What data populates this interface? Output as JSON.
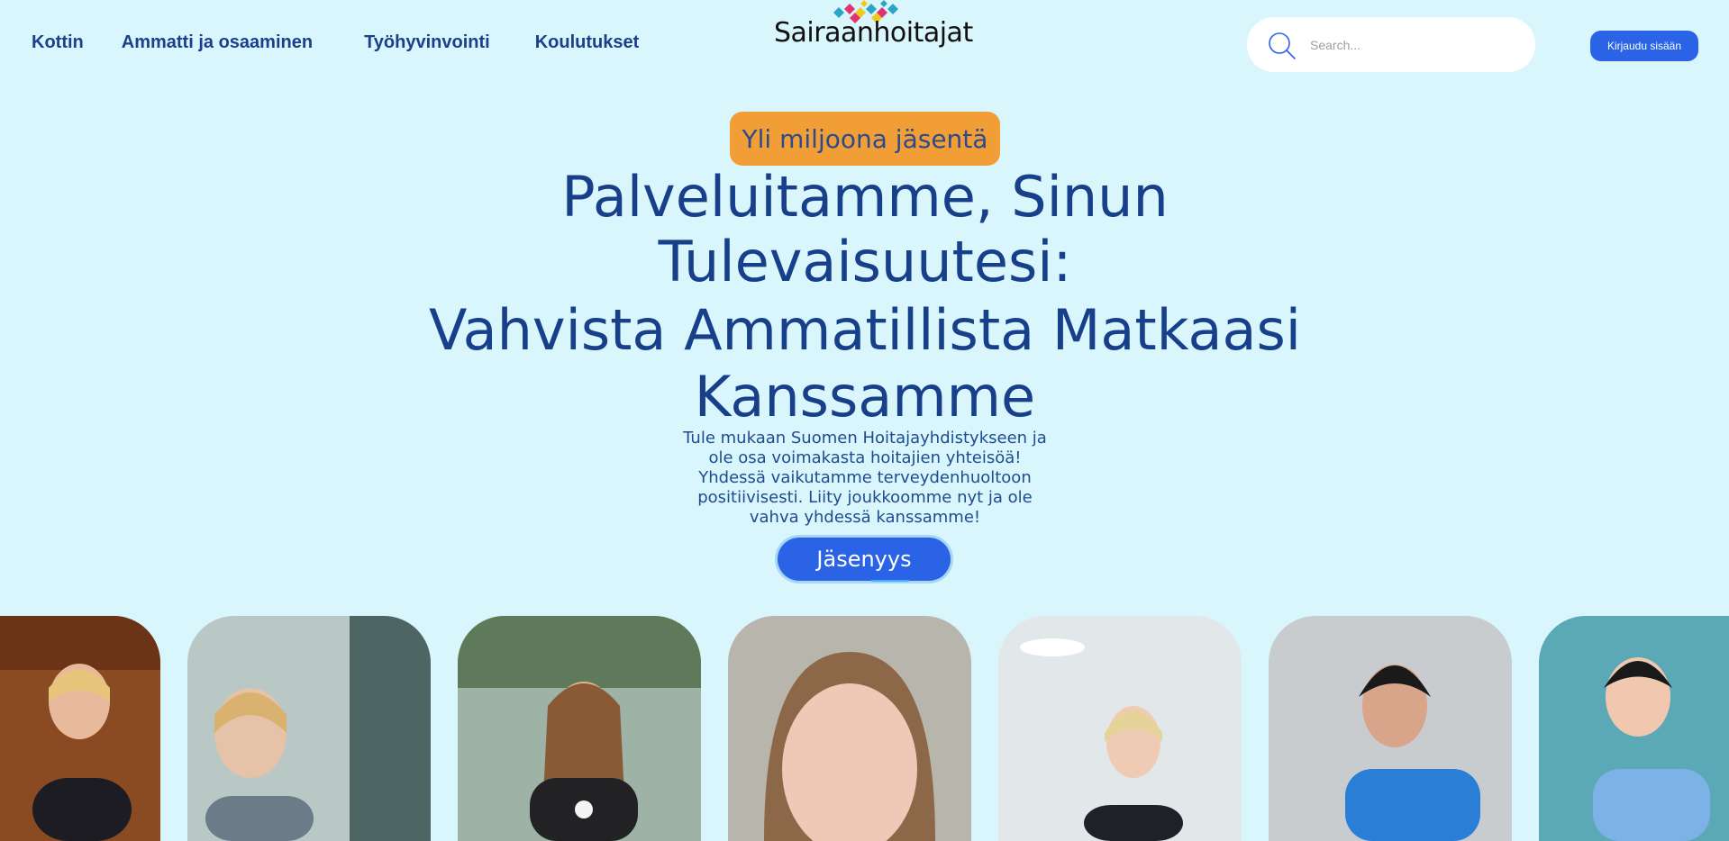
{
  "nav": {
    "items": [
      {
        "label": "Kottin"
      },
      {
        "label": "Ammatti ja osaaminen"
      },
      {
        "label": "Työhyvinvointi"
      },
      {
        "label": "Koulutukset"
      }
    ]
  },
  "logo": {
    "text": "Sairaanhoitajat"
  },
  "search": {
    "placeholder": "Search..."
  },
  "header": {
    "login_label": "Kirjaudu sisään"
  },
  "hero": {
    "badge": "Yli miljoona jäsentä",
    "title_line1": "Palveluitamme, Sinun",
    "title_line2": "Tulevaisuutesi:",
    "subtitle_line1": "Vahvista Ammatillista Matkaasi",
    "subtitle_line2": "Kanssamme",
    "intro": "Tule mukaan Suomen Hoitajayhdistykseen ja ole osa voimakasta hoitajien yhteisöä! Yhdessä vaikutamme terveydenhuoltoon positiivisesti. Liity joukkoomme nyt ja ole vahva yhdessä kanssamme!",
    "cta_label": "Jäsenyys"
  },
  "colors": {
    "background": "#d9f6fd",
    "primary_text": "#173f8a",
    "accent_button": "#2a63e6",
    "badge": "#f29e36"
  }
}
